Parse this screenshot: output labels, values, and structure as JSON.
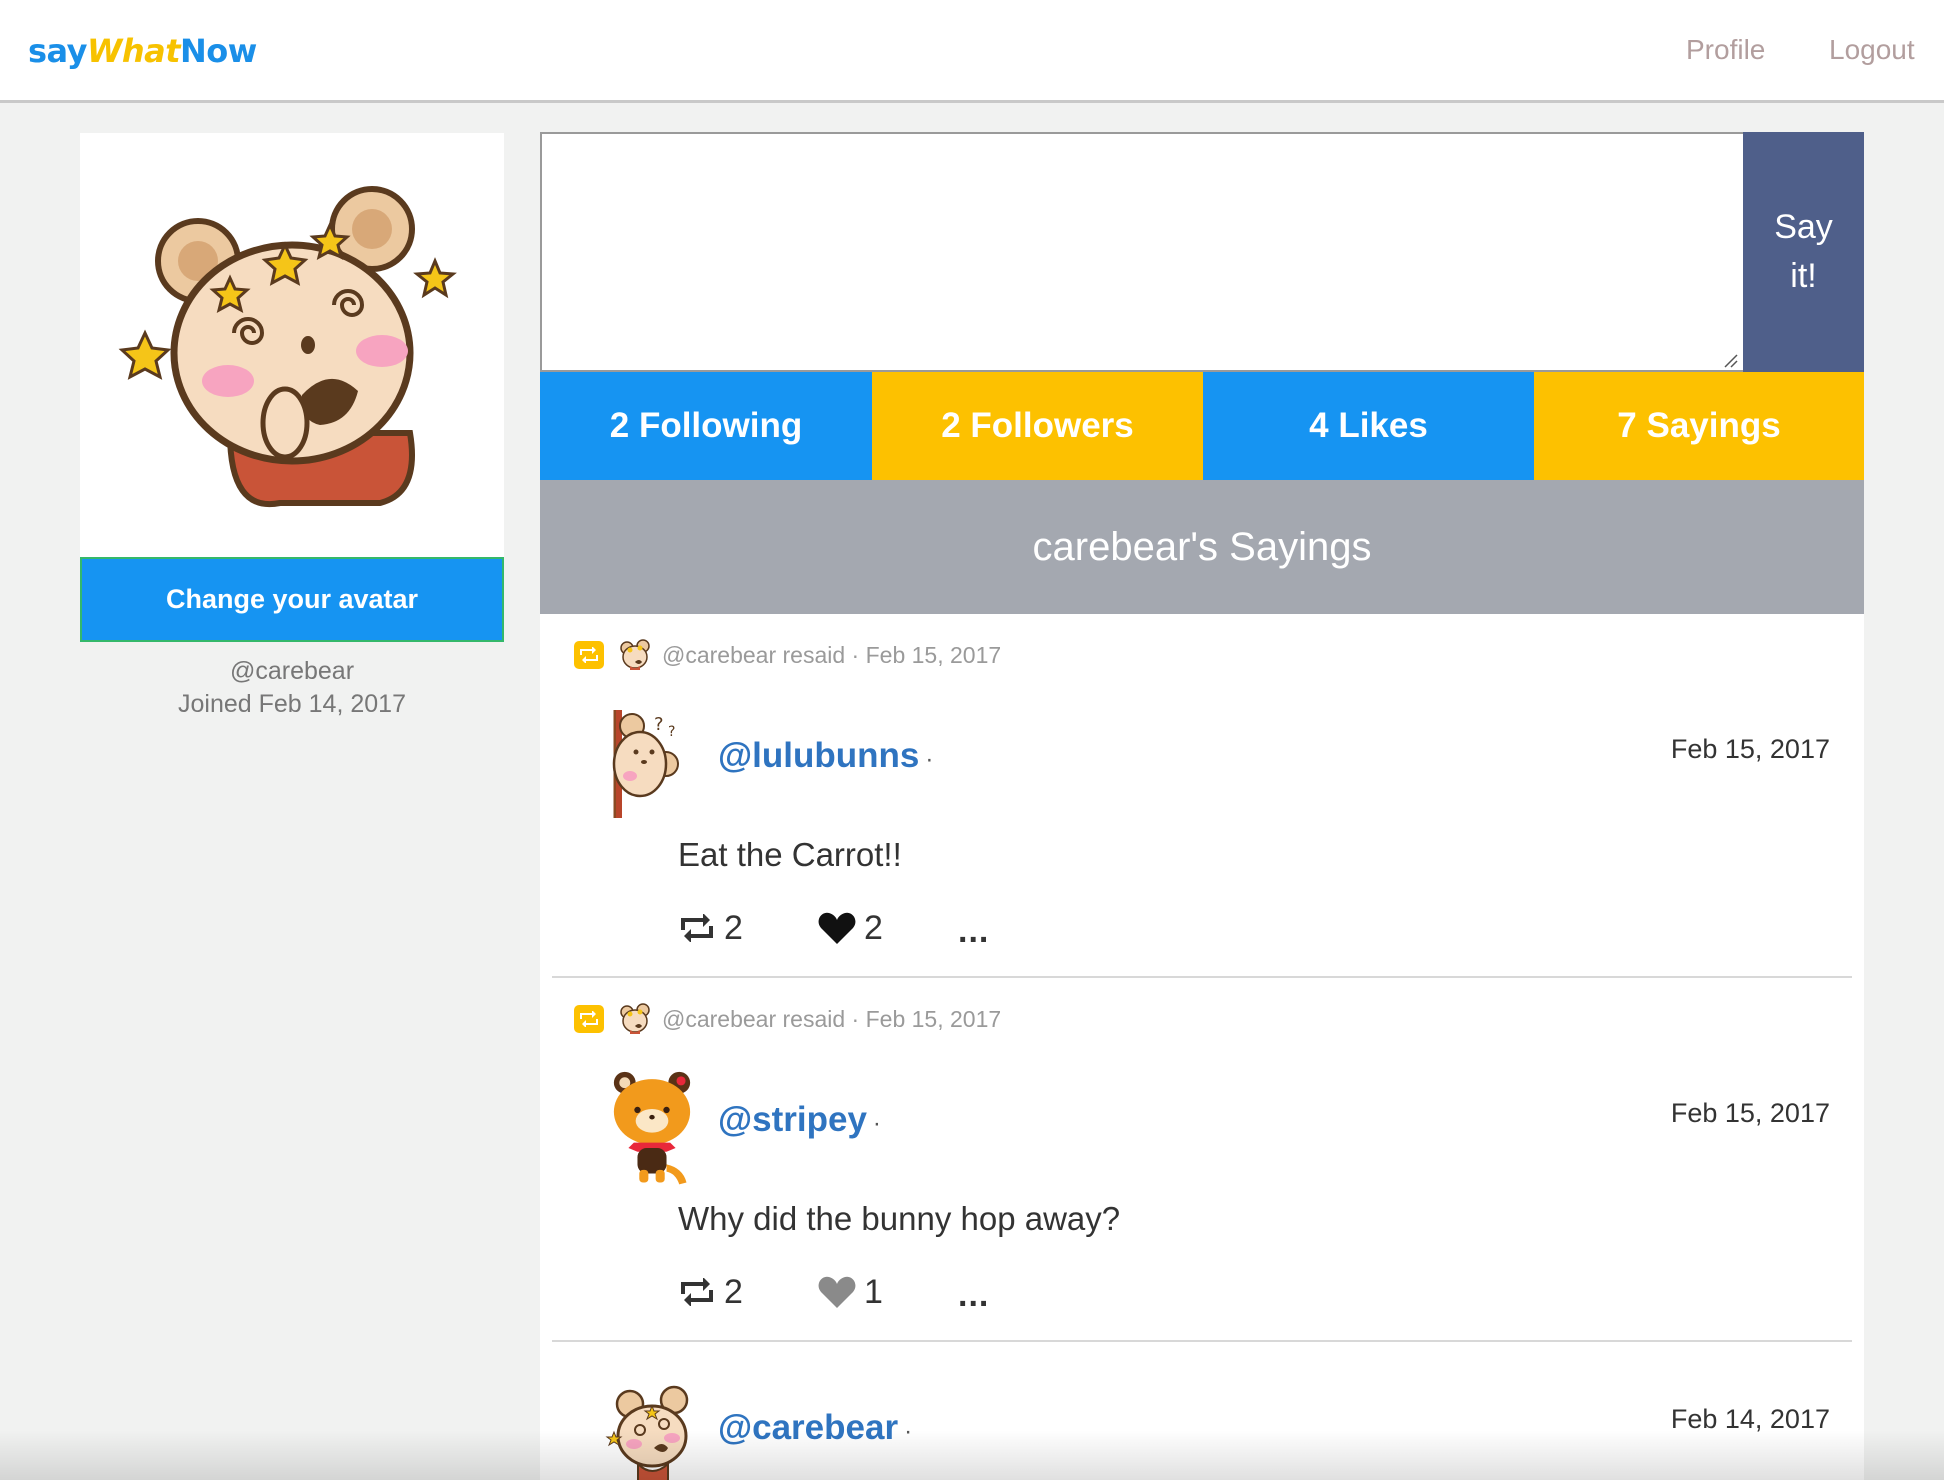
{
  "brand": {
    "part1": "say",
    "part2": "What",
    "part3": "Now"
  },
  "nav": {
    "profile": "Profile",
    "logout": "Logout"
  },
  "profile": {
    "change_avatar_label": "Change your avatar",
    "handle": "@carebear",
    "joined": "Joined Feb 14, 2017"
  },
  "composer": {
    "value": "",
    "say_line1": "Say",
    "say_line2": "it!"
  },
  "stats": {
    "following": "2 Following",
    "followers": "2 Followers",
    "likes": "4 Likes",
    "sayings": "7 Sayings"
  },
  "section_title": "carebear's Sayings",
  "posts": [
    {
      "resaid": "@carebear resaid · Feb 15, 2017",
      "handle": "@lulubunns",
      "date": "Feb 15, 2017",
      "text": "Eat the Carrot!!",
      "resay_count": "2",
      "like_count": "2",
      "liked": true,
      "more": "..."
    },
    {
      "resaid": "@carebear resaid · Feb 15, 2017",
      "handle": "@stripey",
      "date": "Feb 15, 2017",
      "text": "Why did the bunny hop away?",
      "resay_count": "2",
      "like_count": "1",
      "liked": false,
      "more": "..."
    },
    {
      "handle": "@carebear",
      "date": "Feb 14, 2017"
    }
  ],
  "icons": {
    "retweet": "retweet-icon",
    "heart": "heart-icon",
    "avatar_dizzy_bear": "dizzy-bear-avatar",
    "avatar_peek_bear": "peeking-bear-avatar",
    "avatar_red_panda": "red-panda-avatar"
  },
  "colors": {
    "blue": "#1694f2",
    "yellow": "#fdc100",
    "say_button": "#4f5f8a",
    "header_gray": "#a4a8b0",
    "handle_link": "#2f74c0"
  }
}
